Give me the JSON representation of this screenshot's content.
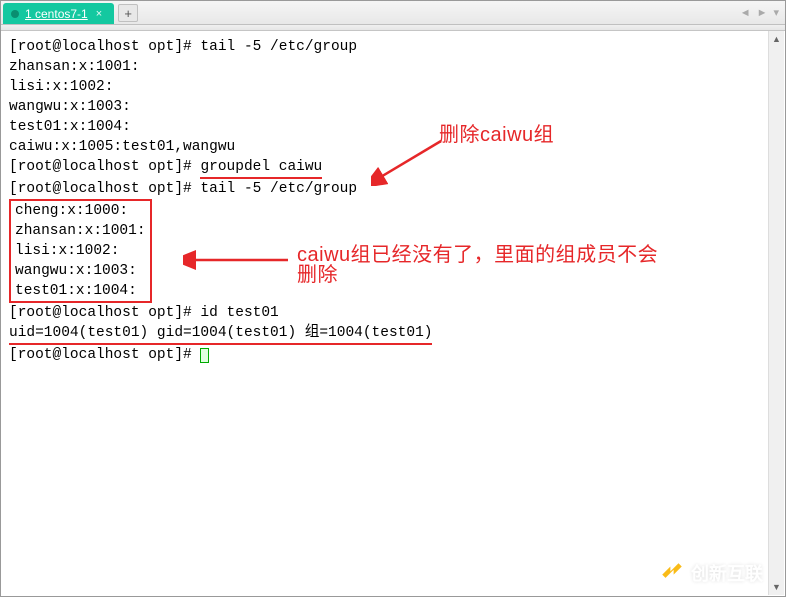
{
  "tabbar": {
    "active_label": "1 centos7-1",
    "add_symbol": "+",
    "nav_left": "◄",
    "nav_right": "►",
    "nav_menu": "▾"
  },
  "terminal": {
    "lines": [
      "[root@localhost opt]# tail -5 /etc/group",
      "zhansan:x:1001:",
      "lisi:x:1002:",
      "wangwu:x:1003:",
      "test01:x:1004:",
      "caiwu:x:1005:test01,wangwu",
      "[root@localhost opt]# groupdel caiwu",
      "[root@localhost opt]# tail -5 /etc/group"
    ],
    "boxlines": [
      "cheng:x:1000:",
      "zhansan:x:1001:",
      "lisi:x:1002:",
      "wangwu:x:1003:",
      "test01:x:1004:"
    ],
    "after_box": [
      "[root@localhost opt]# id test01",
      "uid=1004(test01) gid=1004(test01) 组=1004(test01)"
    ],
    "prompt_final": "[root@localhost opt]# "
  },
  "annotations": {
    "anno1": "删除caiwu组",
    "anno2a": "caiwu组已经没有了，里面的组成员不会",
    "anno2b": "删除"
  },
  "watermark": {
    "text": "创新互联"
  },
  "colors": {
    "annotation_red": "#e62729",
    "tab_green": "#14c8a0"
  }
}
